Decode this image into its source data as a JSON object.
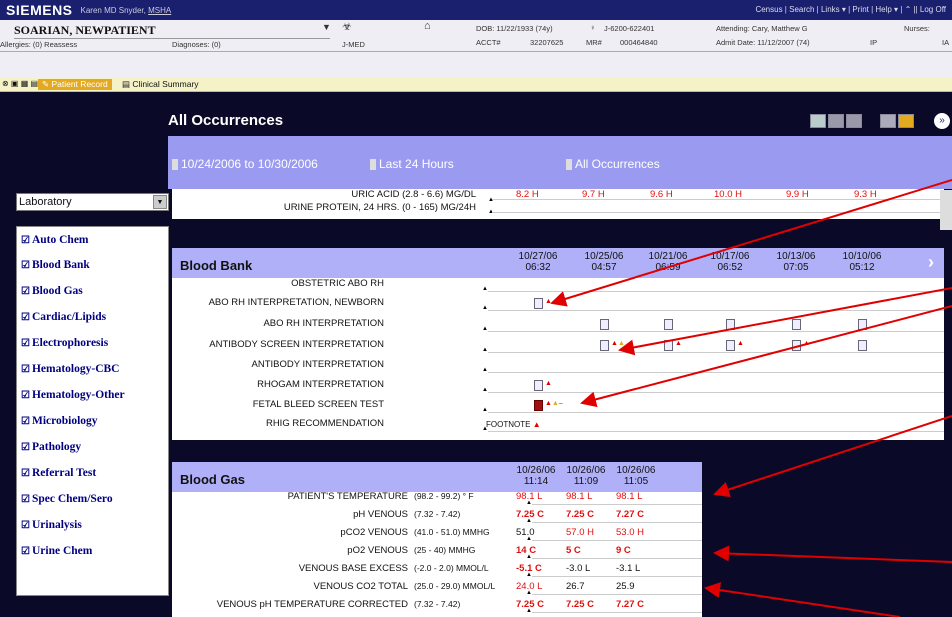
{
  "topbar": {
    "brand": "SIEMENS",
    "user": "Karen MD Snyder,",
    "user_org": "MSHA",
    "links": "Census  |  Search  |  Links ▾  |  Print  |  Help ▾  |  ⌃  ||  Log Off"
  },
  "patient": {
    "name": "SOARIAN, NEWPATIENT",
    "dob": "DOB: 11/22/1933  (74y)",
    "id": "J-6200-622401",
    "attending": "Attending: Cary, Matthew G",
    "nurses": "Nurses:",
    "allergies": "Allergies:  (0) Reassess",
    "diagnoses": "Diagnoses:  (0)",
    "unit": "J-MED",
    "acct_label": "ACCT#",
    "acct": "32207625",
    "mr_label": "MR#",
    "mr": "000464840",
    "admit": "Admit Date:  11/12/2007 (74)",
    "ip": "IP",
    "ia": "IA"
  },
  "tabs": {
    "patient_record": "Patient Record",
    "clinical_summary": "Clinical Summary"
  },
  "page": {
    "title": "All Occurrences",
    "filter_range": "10/24/2006 to 10/30/2006",
    "filter_period": "Last 24 Hours",
    "filter_type": "All Occurrences"
  },
  "sidebar": {
    "select_value": "Laboratory",
    "items": [
      "Auto Chem",
      "Blood Bank",
      "Blood Gas",
      "Cardiac/Lipids",
      "Electrophoresis",
      "Hematology-CBC",
      "Hematology-Other",
      "Microbiology",
      "Pathology",
      "Referral Test",
      "Spec Chem/Sero",
      "Urinalysis",
      "Urine Chem"
    ]
  },
  "urine": {
    "rows": [
      {
        "label": "URIC ACID  (2.8 - 6.6) MG/DL",
        "values": [
          "8.2  H",
          "9.7  H",
          "9.6  H",
          "10.0  H",
          "9.9  H",
          "9.3  H"
        ]
      },
      {
        "label": "URINE PROTEIN, 24 HRS.  (0 - 165) MG/24H",
        "values": []
      }
    ]
  },
  "blood_bank": {
    "title": "Blood Bank",
    "dates": [
      "10/27/06",
      "10/25/06",
      "10/21/06",
      "10/17/06",
      "10/13/06",
      "10/10/06"
    ],
    "times": [
      "06:32",
      "04:57",
      "06:59",
      "06:52",
      "07:05",
      "05:12"
    ],
    "rows": [
      "OBSTETRIC ABO RH",
      "ABO RH INTERPRETATION, NEWBORN",
      "ABO RH INTERPRETATION",
      "ANTIBODY SCREEN INTERPRETATION",
      "ANTIBODY INTERPRETATION",
      "RHOGAM INTERPRETATION",
      "FETAL BLEED SCREEN TEST",
      "RHIG RECOMMENDATION"
    ],
    "footnote": "FOOTNOTE"
  },
  "blood_gas": {
    "title": "Blood Gas",
    "dates": [
      "10/26/06",
      "10/26/06",
      "10/26/06"
    ],
    "times": [
      "11:14",
      "11:09",
      "11:05"
    ],
    "rows": [
      {
        "label": "PATIENT'S TEMPERATURE",
        "range": "(98.2 - 99.2) ° F",
        "values": [
          "98.1   L",
          "98.1   L",
          "98.1   L"
        ],
        "red": [
          true,
          true,
          true
        ],
        "bold": [
          false,
          false,
          false
        ]
      },
      {
        "label": "pH VENOUS",
        "range": "(7.32 - 7.42)",
        "values": [
          "7.25   C",
          "7.25   C",
          "7.27   C"
        ],
        "red": [
          true,
          true,
          true
        ],
        "bold": [
          true,
          true,
          true
        ]
      },
      {
        "label": "pCO2 VENOUS",
        "range": "(41.0 - 51.0) MMHG",
        "values": [
          "51.0",
          "57.0   H",
          "53.0   H"
        ],
        "red": [
          false,
          true,
          true
        ],
        "bold": [
          false,
          false,
          false
        ]
      },
      {
        "label": "pO2 VENOUS",
        "range": "(25 - 40) MMHG",
        "values": [
          "14   C",
          "5   C",
          "9   C"
        ],
        "red": [
          true,
          true,
          true
        ],
        "bold": [
          true,
          true,
          true
        ]
      },
      {
        "label": "VENOUS BASE EXCESS",
        "range": "(-2.0 - 2.0) MMOL/L",
        "values": [
          "-5.1   C",
          "-3.0   L",
          "-3.1   L"
        ],
        "red": [
          true,
          false,
          false
        ],
        "bold": [
          true,
          false,
          false
        ]
      },
      {
        "label": "VENOUS CO2 TOTAL",
        "range": "(25.0 - 29.0) MMOL/L",
        "values": [
          "24.0   L",
          "26.7",
          "25.9"
        ],
        "red": [
          true,
          false,
          false
        ],
        "bold": [
          false,
          false,
          false
        ]
      },
      {
        "label": "VENOUS pH TEMPERATURE CORRECTED",
        "range": "(7.32 - 7.42)",
        "values": [
          "7.25   C",
          "7.25   C",
          "7.27   C"
        ],
        "red": [
          true,
          true,
          true
        ],
        "bold": [
          true,
          true,
          true
        ]
      }
    ]
  },
  "colors": {
    "accent": "#1a1f6e",
    "filter_bar": "#9a9af0",
    "section_header": "#b0b0f8",
    "critical": "#e01010"
  }
}
